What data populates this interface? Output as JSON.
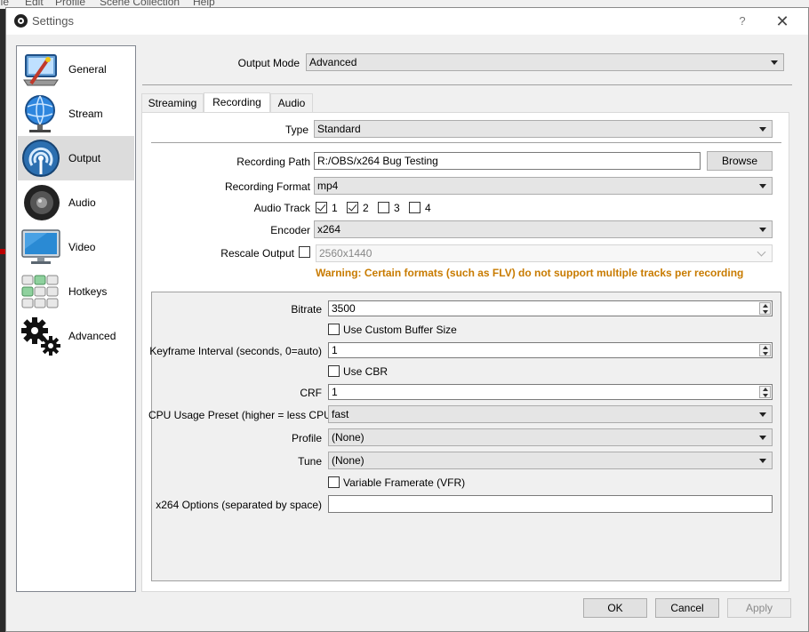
{
  "background_app": {
    "menu": [
      "ile",
      "Edit",
      "Profile",
      "Scene Collection",
      "Help"
    ]
  },
  "dialog": {
    "title": "Settings",
    "help_label": "?",
    "close_label": "✕"
  },
  "sidebar": {
    "items": [
      {
        "label": "General",
        "icon": "general-icon"
      },
      {
        "label": "Stream",
        "icon": "stream-icon"
      },
      {
        "label": "Output",
        "icon": "output-icon",
        "selected": true
      },
      {
        "label": "Audio",
        "icon": "audio-icon"
      },
      {
        "label": "Video",
        "icon": "video-icon"
      },
      {
        "label": "Hotkeys",
        "icon": "hotkeys-icon"
      },
      {
        "label": "Advanced",
        "icon": "advanced-icon"
      }
    ]
  },
  "output_mode": {
    "label": "Output Mode",
    "value": "Advanced"
  },
  "tabs": [
    {
      "label": "Streaming"
    },
    {
      "label": "Recording",
      "active": true
    },
    {
      "label": "Audio"
    }
  ],
  "recording": {
    "type": {
      "label": "Type",
      "value": "Standard"
    },
    "path": {
      "label": "Recording Path",
      "value": "R:/OBS/x264 Bug Testing",
      "browse_label": "Browse"
    },
    "format": {
      "label": "Recording Format",
      "value": "mp4"
    },
    "audio_track": {
      "label": "Audio Track",
      "tracks": [
        {
          "label": "1",
          "checked": true
        },
        {
          "label": "2",
          "checked": true
        },
        {
          "label": "3",
          "checked": false
        },
        {
          "label": "4",
          "checked": false
        }
      ]
    },
    "encoder": {
      "label": "Encoder",
      "value": "x264"
    },
    "rescale": {
      "label": "Rescale Output",
      "checked": false,
      "value": "2560x1440"
    },
    "warning": "Warning: Certain formats (such as FLV) do not support multiple tracks per recording"
  },
  "encoder_settings": {
    "bitrate": {
      "label": "Bitrate",
      "value": "3500"
    },
    "custom_buffer": {
      "label": "Use Custom Buffer Size",
      "checked": false
    },
    "keyframe": {
      "label": "Keyframe Interval (seconds, 0=auto)",
      "value": "1"
    },
    "cbr": {
      "label": "Use CBR",
      "checked": false
    },
    "crf": {
      "label": "CRF",
      "value": "1"
    },
    "cpu_preset": {
      "label": "CPU Usage Preset (higher = less CPU)",
      "value": "fast"
    },
    "profile": {
      "label": "Profile",
      "value": "(None)"
    },
    "tune": {
      "label": "Tune",
      "value": "(None)"
    },
    "vfr": {
      "label": "Variable Framerate (VFR)",
      "checked": false
    },
    "x264_options": {
      "label": "x264 Options (separated by space)",
      "value": ""
    }
  },
  "footer": {
    "ok_label": "OK",
    "cancel_label": "Cancel",
    "apply_label": "Apply"
  },
  "colors": {
    "warning": "#c87b00",
    "selected_item": "#dcdcdc",
    "dialog_bg": "#f0f0f0"
  }
}
